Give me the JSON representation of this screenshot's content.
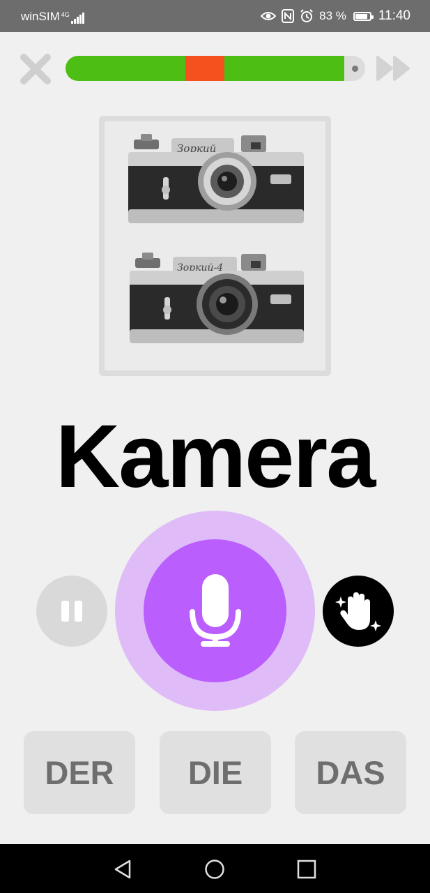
{
  "status_bar": {
    "carrier": "winSIM",
    "network": "4G",
    "battery_percent": "83 %",
    "battery_level": 0.83,
    "time": "11:40",
    "icons": [
      "eye-icon",
      "nfc-icon",
      "alarm-icon",
      "battery-icon"
    ]
  },
  "top_bar": {
    "close_icon": "close-icon",
    "skip_icon": "fast-forward-icon",
    "progress_segments": [
      {
        "status": "correct",
        "color": "#4cbe14"
      },
      {
        "status": "wrong",
        "color": "#f4511e"
      },
      {
        "status": "correct",
        "color": "#4cbe14"
      }
    ]
  },
  "card": {
    "image_alt_icon": "camera-photo",
    "image_engraving": [
      "Зоркий",
      "Зоркий-4"
    ]
  },
  "word": {
    "text": "Kamera"
  },
  "controls": {
    "pause_icon": "pause-icon",
    "mic_icon": "microphone-icon",
    "hint_icon": "sparkle-hand-icon",
    "mic_color": "#bb5efe",
    "mic_ring_color": "#dfbcf7"
  },
  "articles": [
    {
      "label": "DER"
    },
    {
      "label": "DIE"
    },
    {
      "label": "DAS"
    }
  ],
  "nav_bar": {
    "icons": [
      "back-triangle-icon",
      "home-circle-icon",
      "recents-square-icon"
    ]
  }
}
